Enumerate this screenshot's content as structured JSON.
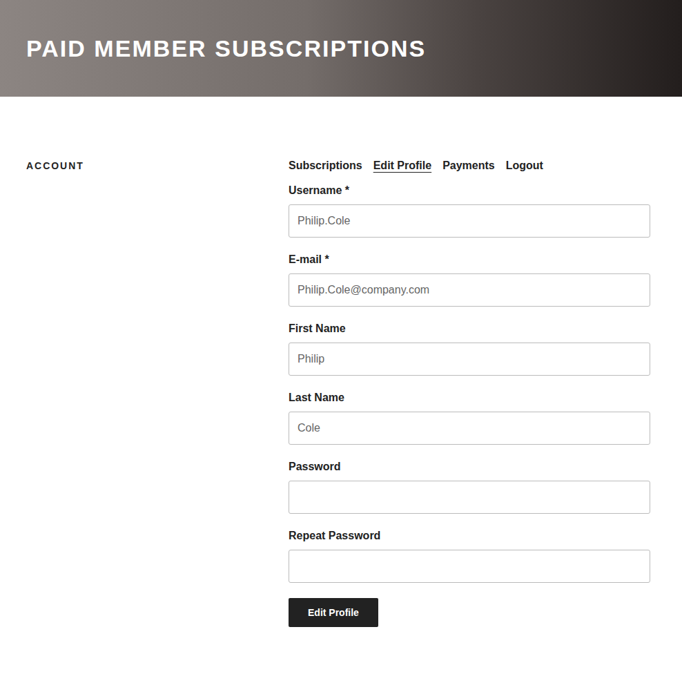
{
  "header": {
    "title": "PAID MEMBER SUBSCRIPTIONS"
  },
  "sidebar": {
    "title": "ACCOUNT"
  },
  "tabs": [
    {
      "label": "Subscriptions",
      "selected": false
    },
    {
      "label": "Edit Profile",
      "selected": true
    },
    {
      "label": "Payments",
      "selected": false
    },
    {
      "label": "Logout",
      "selected": false
    }
  ],
  "fields": [
    {
      "label": "Username *",
      "value": "Philip.Cole",
      "kind": "text"
    },
    {
      "label": "E-mail *",
      "value": "Philip.Cole@company.com",
      "kind": "text"
    },
    {
      "label": "First Name",
      "value": "Philip",
      "kind": "text"
    },
    {
      "label": "Last Name",
      "value": "Cole",
      "kind": "text"
    },
    {
      "label": "Password",
      "value": "",
      "kind": "password"
    },
    {
      "label": "Repeat Password",
      "value": "",
      "kind": "password"
    }
  ],
  "button": "Edit Profile"
}
